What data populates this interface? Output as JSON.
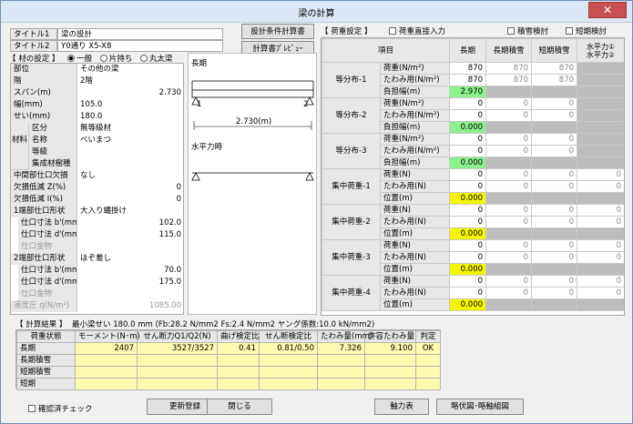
{
  "window": {
    "title": "梁の計算",
    "close_glyph": "✕"
  },
  "header": {
    "title1_label": "タイトル1",
    "title1_value": "梁の設計",
    "title2_label": "タイトル2",
    "title2_value": "Y0通り X5-X8",
    "btn_calc_sheet": "設計条件計算書",
    "btn_preview": "計算書ﾌﾟﾚﾋﾞｭｰ"
  },
  "material": {
    "section_label": "【 材の設定 】",
    "options": [
      {
        "label": "一般",
        "selected": true
      },
      {
        "label": "片持ち",
        "selected": false
      },
      {
        "label": "丸太梁",
        "selected": false
      }
    ],
    "group_label": "材料",
    "rows": [
      {
        "label": "部位",
        "value": "その他の梁"
      },
      {
        "label": "階",
        "value": "2階"
      },
      {
        "label": "スパン(m)",
        "value": "2.730"
      },
      {
        "label": "幅(mm)",
        "value": "105.0"
      },
      {
        "label": "せい(mm)",
        "value": "180.0"
      },
      {
        "label": "区分",
        "value": "無等級材"
      },
      {
        "label": "名称",
        "value": "べいまつ"
      },
      {
        "label": "等級",
        "value": ""
      },
      {
        "label": "集成材樹種",
        "value": ""
      },
      {
        "label": "中間部仕口欠損",
        "value": "なし"
      },
      {
        "label": "欠損低減 Z(%)",
        "value": "0"
      },
      {
        "label": "欠損低減 I(%)",
        "value": "0"
      },
      {
        "label": "1端部仕口形状",
        "value": "大入り蟻掛け"
      },
      {
        "label": "仕口寸法 b'(mm)",
        "value": "102.0"
      },
      {
        "label": "仕口寸法 d'(mm)",
        "value": "115.0"
      },
      {
        "label": "仕口金物",
        "value": ""
      },
      {
        "label": "2端部仕口形状",
        "value": "ほぞ差し"
      },
      {
        "label": "仕口寸法 b'(mm)",
        "value": "70.0"
      },
      {
        "label": "仕口寸法 d'(mm)",
        "value": "175.0"
      },
      {
        "label": "仕口金物",
        "value": ""
      },
      {
        "label": "速度圧 q(N/m²)",
        "value": "1085.00"
      }
    ]
  },
  "diagram": {
    "long_label": "長期",
    "span_label": "2.730(m)",
    "node1": "1",
    "node2": "2",
    "horizontal_label": "水平力時"
  },
  "load": {
    "section_label": "【 荷重設定 】",
    "chk_direct": "荷重直接入力",
    "chk_snow": "積雪検討",
    "chk_short": "短期検討",
    "headers": [
      "項目",
      "長期",
      "長期積雪",
      "短期積雪",
      "水平力①",
      "水平力②"
    ],
    "dist_groups": [
      {
        "name": "等分布-1",
        "rows": [
          {
            "item": "荷重(N/m²)",
            "long": "870",
            "ls": "870",
            "ss": "870"
          },
          {
            "item": "たわみ用(N/m²)",
            "long": "870",
            "ls": "870",
            "ss": "870"
          },
          {
            "item": "負担幅(m)",
            "long": "2.970"
          }
        ]
      },
      {
        "name": "等分布-2",
        "rows": [
          {
            "item": "荷重(N/m²)",
            "long": "0",
            "ls": "0",
            "ss": "0"
          },
          {
            "item": "たわみ用(N/m²)",
            "long": "0",
            "ls": "0",
            "ss": "0"
          },
          {
            "item": "負担幅(m)",
            "long": "0.000"
          }
        ]
      },
      {
        "name": "等分布-3",
        "rows": [
          {
            "item": "荷重(N/m²)",
            "long": "0",
            "ls": "0",
            "ss": "0"
          },
          {
            "item": "たわみ用(N/m²)",
            "long": "0",
            "ls": "0",
            "ss": "0"
          },
          {
            "item": "負担幅(m)",
            "long": "0.000"
          }
        ]
      }
    ],
    "conc_groups": [
      {
        "name": "集中荷重-1",
        "rows": [
          {
            "item": "荷重(N)",
            "long": "0",
            "ls": "0",
            "ss": "0",
            "h1": "0"
          },
          {
            "item": "たわみ用(N)",
            "long": "0",
            "ls": "0",
            "ss": "0",
            "h1": "0"
          },
          {
            "item": "位置(m)",
            "long": "0.000"
          }
        ]
      },
      {
        "name": "集中荷重-2",
        "rows": [
          {
            "item": "荷重(N)",
            "long": "0",
            "ls": "0",
            "ss": "0",
            "h1": "0"
          },
          {
            "item": "たわみ用(N)",
            "long": "0",
            "ls": "0",
            "ss": "0",
            "h1": "0"
          },
          {
            "item": "位置(m)",
            "long": "0.000"
          }
        ]
      },
      {
        "name": "集中荷重-3",
        "rows": [
          {
            "item": "荷重(N)",
            "long": "0",
            "ls": "0",
            "ss": "0",
            "h1": "0"
          },
          {
            "item": "たわみ用(N)",
            "long": "0",
            "ls": "0",
            "ss": "0",
            "h1": "0"
          },
          {
            "item": "位置(m)",
            "long": "0.000"
          }
        ]
      },
      {
        "name": "集中荷重-4",
        "rows": [
          {
            "item": "荷重(N)",
            "long": "0",
            "ls": "0",
            "ss": "0",
            "h1": "0"
          },
          {
            "item": "たわみ用(N)",
            "long": "0",
            "ls": "0",
            "ss": "0",
            "h1": "0"
          },
          {
            "item": "位置(m)",
            "long": "0.000"
          }
        ]
      }
    ]
  },
  "results": {
    "section_label": "【 計算結果 】",
    "summary": "最小梁せい 180.0 mm   (Fb:28.2 N/mm2  Fs:2.4 N/mm2 ヤング係数:10.0 kN/mm2)",
    "headers": [
      "荷重状態",
      "モーメント(N･m)",
      "せん断力Q1/Q2(N)",
      "曲げ検定比",
      "せん断検定比",
      "たわみ量(mm)",
      "許容たわみ量",
      "判定"
    ],
    "rows": [
      {
        "state": "長期",
        "moment": "2407",
        "shear": "3527/3527",
        "bend": "0.41",
        "shear_ratio": "0.81/0.50",
        "defl": "7.326",
        "allow": "9.100",
        "judge": "OK"
      },
      {
        "state": "長期積雪",
        "moment": "",
        "shear": "",
        "bend": "",
        "shear_ratio": "",
        "defl": "",
        "allow": "",
        "judge": ""
      },
      {
        "state": "短期積雪",
        "moment": "",
        "shear": "",
        "bend": "",
        "shear_ratio": "",
        "defl": "",
        "allow": "",
        "judge": ""
      },
      {
        "state": "短期",
        "moment": "",
        "shear": "",
        "bend": "",
        "shear_ratio": "",
        "defl": "",
        "allow": "",
        "judge": ""
      }
    ]
  },
  "footer": {
    "confirm_check": "確認済チェック",
    "btn_update": "更新登録",
    "btn_close": "閉じる",
    "btn_axial": "軸力表",
    "btn_outline": "略伏図･略軸組図"
  }
}
